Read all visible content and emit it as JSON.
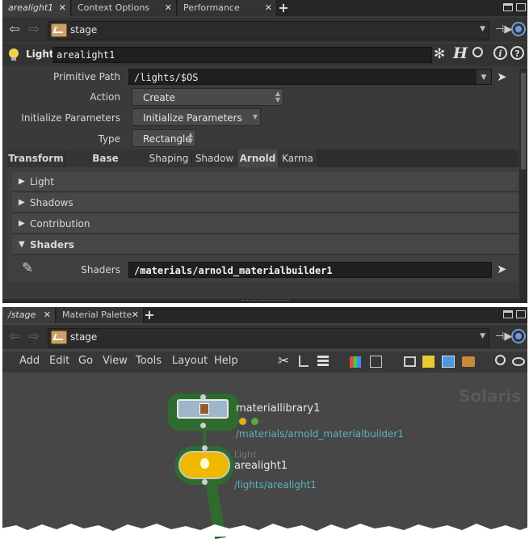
{
  "top_tabs": [
    {
      "label": "arealight1",
      "active": true
    },
    {
      "label": "Context Options Editor",
      "active": false
    },
    {
      "label": "Performance Monitor",
      "active": false
    }
  ],
  "top_path": {
    "label": "stage"
  },
  "node_header": {
    "type_label": "Light",
    "node_name": "arealight1"
  },
  "params": {
    "primitive_path_label": "Primitive Path",
    "primitive_path_value": "/lights/$OS",
    "action_label": "Action",
    "action_value": "Create",
    "init_label": "Initialize Parameters",
    "init_value": "Initialize Parameters",
    "type_label": "Type",
    "type_value": "Rectangle"
  },
  "param_tabs": [
    "Transform",
    "Base Properties",
    "Shaping",
    "Shadow",
    "Arnold",
    "Karma"
  ],
  "folders": [
    "Light",
    "Shadows",
    "Contribution",
    "Shaders"
  ],
  "shaders": {
    "label": "Shaders",
    "value": "/materials/arnold_materialbuilder1"
  },
  "bottom_tabs": [
    {
      "label": "/stage",
      "active": true
    },
    {
      "label": "Material Palette",
      "active": false
    }
  ],
  "bottom_path": {
    "label": "stage"
  },
  "network_menu": [
    "Add",
    "Edit",
    "Go",
    "View",
    "Tools",
    "Layout",
    "Help"
  ],
  "network": {
    "watermark": "Solaris",
    "nodes": [
      {
        "name": "materiallibrary1",
        "path": "/materials/arnold_materialbuilder1",
        "type": ""
      },
      {
        "name": "arealight1",
        "path": "/lights/arealight1",
        "type": "Light"
      }
    ]
  },
  "colors": {
    "accent_path": "#5fb3b3",
    "node_ring": "#2e6b2e",
    "light_node": "#f0b800"
  },
  "icons": [
    "back-arrow-icon",
    "forward-arrow-icon",
    "lightbulb-icon",
    "gear-icon",
    "houdini-h-icon",
    "search-icon",
    "info-icon",
    "help-icon",
    "pencil-icon",
    "wrench-icon",
    "eye-icon"
  ]
}
